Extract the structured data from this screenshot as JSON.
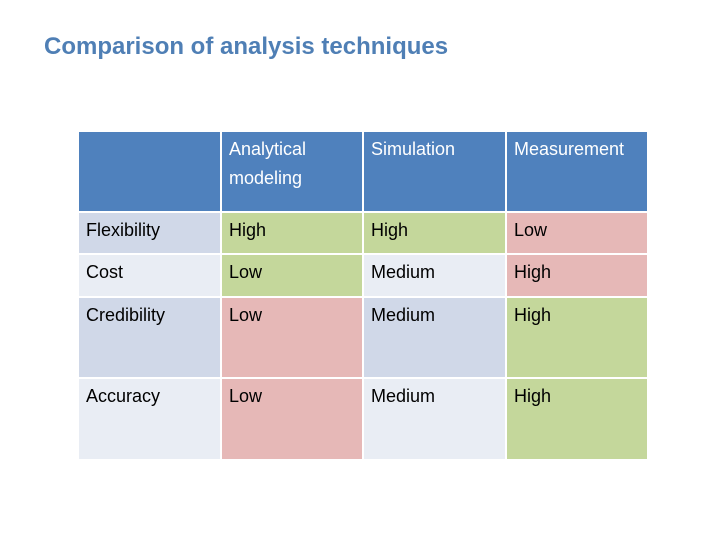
{
  "title": "Comparison of analysis techniques",
  "palette": {
    "title_text": "#4f7fb5",
    "header_fill": "#4f81bd",
    "header_text": "#ffffff",
    "row_band_dark": "#d0d8e8",
    "row_band_light": "#e9edf4",
    "favorable_green": "#c4d79b",
    "unfavorable_red": "#e6b8b7"
  },
  "table": {
    "corner": "",
    "columns": [
      "Analytical modeling",
      "Simulation",
      "Measurement"
    ],
    "rows": [
      {
        "criterion": "Flexibility",
        "cells": [
          {
            "value": "High",
            "rating": "favorable"
          },
          {
            "value": "High",
            "rating": "favorable"
          },
          {
            "value": "Low",
            "rating": "unfavorable"
          }
        ]
      },
      {
        "criterion": "Cost",
        "cells": [
          {
            "value": "Low",
            "rating": "favorable"
          },
          {
            "value": "Medium",
            "rating": "neutral"
          },
          {
            "value": "High",
            "rating": "unfavorable"
          }
        ]
      },
      {
        "criterion": "Credibility",
        "cells": [
          {
            "value": "Low",
            "rating": "unfavorable"
          },
          {
            "value": "Medium",
            "rating": "neutral"
          },
          {
            "value": "High",
            "rating": "favorable"
          }
        ]
      },
      {
        "criterion": "Accuracy",
        "cells": [
          {
            "value": "Low",
            "rating": "unfavorable"
          },
          {
            "value": "Medium",
            "rating": "neutral"
          },
          {
            "value": "High",
            "rating": "favorable"
          }
        ]
      }
    ]
  }
}
